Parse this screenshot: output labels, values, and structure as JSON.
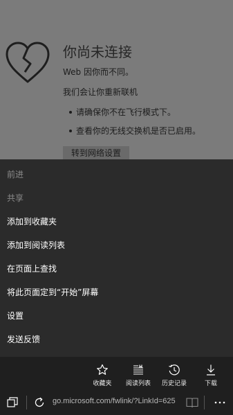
{
  "offline_page": {
    "title": "你尚未连接",
    "line1": "Web 因你而不同。",
    "line2": "我们会让你重新联机",
    "tips": [
      "请确保你不在飞行模式下。",
      "查看你的无线交换机是否已启用。"
    ],
    "network_button": "转到网络设置"
  },
  "menu": {
    "items": [
      {
        "label": "前进",
        "enabled": false
      },
      {
        "label": "共享",
        "enabled": false
      },
      {
        "label": "添加到收藏夹",
        "enabled": true
      },
      {
        "label": "添加到阅读列表",
        "enabled": true
      },
      {
        "label": "在页面上查找",
        "enabled": true
      },
      {
        "label": "将此页面定到“开始”屏幕",
        "enabled": true
      },
      {
        "label": "设置",
        "enabled": true
      },
      {
        "label": "发送反馈",
        "enabled": true
      }
    ]
  },
  "appbar": {
    "actions": [
      {
        "label": "收藏夹",
        "icon": "star-icon"
      },
      {
        "label": "阅读列表",
        "icon": "reading-list-icon"
      },
      {
        "label": "历史记录",
        "icon": "history-icon"
      },
      {
        "label": "下载",
        "icon": "download-icon"
      }
    ],
    "url": "go.microsoft.com/fwlink/?LinkId=625"
  }
}
